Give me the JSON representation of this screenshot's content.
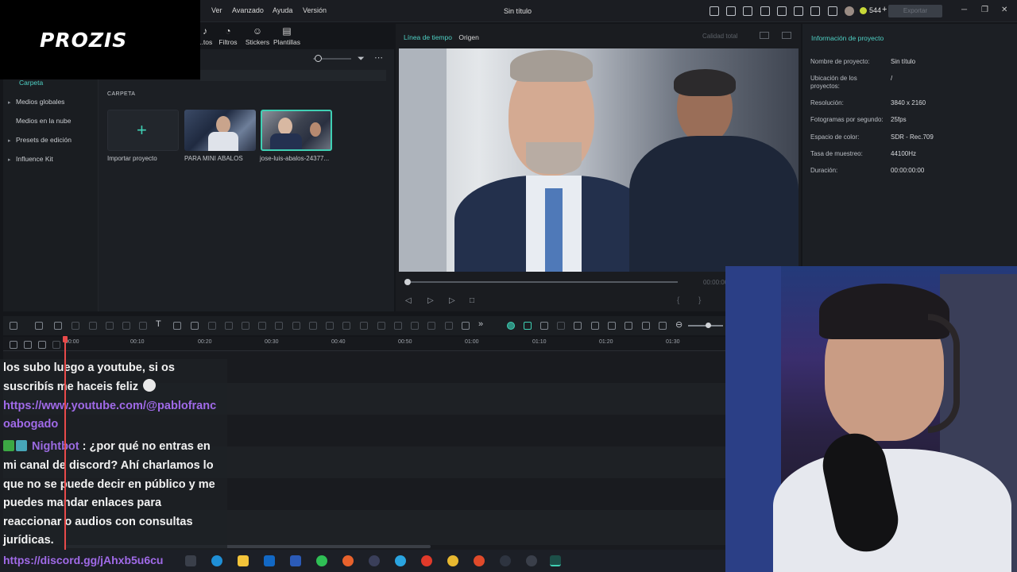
{
  "menu": {
    "items": [
      "Ver",
      "Avanzado",
      "Ayuda",
      "Versión"
    ],
    "title": "Sin título",
    "credits": "544",
    "export": "Exportar"
  },
  "logo": "PROZIS",
  "tools": [
    {
      "label": "...tos",
      "icon": "music-icon"
    },
    {
      "label": "Filtros",
      "icon": "filter-icon"
    },
    {
      "label": "Stickers",
      "icon": "sticker-icon"
    },
    {
      "label": "Plantillas",
      "icon": "template-icon"
    }
  ],
  "media": {
    "active_folder": "Carpeta",
    "sidebar": [
      "Medios globales",
      "Medios en la nube",
      "Presets de edición",
      "Influence Kit"
    ],
    "folder_heading": "CARPETA",
    "items": [
      "Importar proyecto",
      "PARA MINI ABALOS",
      "jose-luis-abalos-24377..."
    ]
  },
  "player": {
    "tab_timeline": "Línea de tiempo",
    "tab_origin": "Origen",
    "quality": "Calidad total",
    "time": "00:00:00"
  },
  "info": {
    "title": "Información de proyecto",
    "rows": [
      {
        "k": "Nombre de proyecto:",
        "v": "Sin título"
      },
      {
        "k": "Ubicación de los proyectos:",
        "v": "/"
      },
      {
        "k": "Resolución:",
        "v": "3840 x 2160"
      },
      {
        "k": "Fotogramas por segundo:",
        "v": "25fps"
      },
      {
        "k": "Espacio de color:",
        "v": "SDR - Rec.709"
      },
      {
        "k": "Tasa de muestreo:",
        "v": "44100Hz"
      },
      {
        "k": "Duración:",
        "v": "00:00:00:00"
      }
    ]
  },
  "timeline": {
    "ticks": [
      "00:00",
      "00:10",
      "00:20",
      "00:30",
      "00:40",
      "00:50",
      "01:00",
      "01:10",
      "01:20",
      "01:30"
    ]
  },
  "chat": {
    "line1": "los subo luego a youtube, si os",
    "line2": "suscribís me haceis feliz",
    "link1a": "https://www.youtube.com/@pablofranc",
    "link1b": "oabogado",
    "user": "Nightbot",
    "msg1": " : ¿por qué no entras en",
    "msg2": "mi canal de discord? Ahí charlamos lo",
    "msg3": "que no se puede decir en público y me",
    "msg4": "puedes mandar enlaces para",
    "msg5": "reaccionar o audios con consultas",
    "msg6": "jurídicas.",
    "link2": "https://discord.gg/jAhxb5u6cu"
  }
}
